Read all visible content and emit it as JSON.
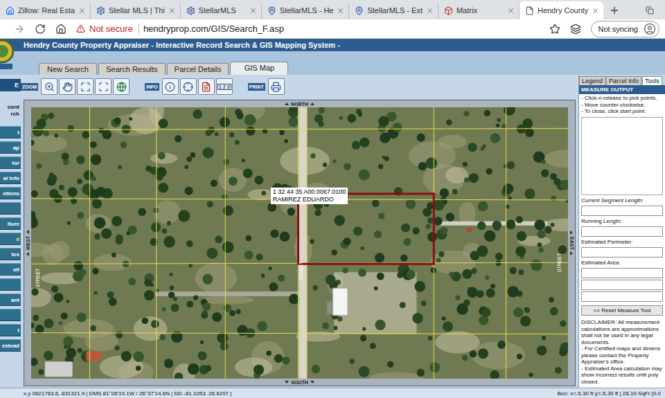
{
  "browser": {
    "tabs": [
      {
        "label": "Zillow: Real Esta",
        "kind": "zillow",
        "selected": false
      },
      {
        "label": "Stellar MLS | Thi",
        "kind": "stellar",
        "selected": false
      },
      {
        "label": "StellarMLS",
        "kind": "stellar",
        "selected": false
      },
      {
        "label": "StellarMLS - He",
        "kind": "pin",
        "selected": false
      },
      {
        "label": "StellarMLS - Ext",
        "kind": "pin",
        "selected": false
      },
      {
        "label": "Matrix",
        "kind": "matrix",
        "selected": false
      },
      {
        "label": "Hendry County",
        "kind": "page",
        "selected": true
      }
    ],
    "address_bar": {
      "security": "Not secure",
      "url": "hendryprop.com/GIS/Search_F.asp"
    },
    "profile_button": "Not syncing"
  },
  "site": {
    "title": "Hendry County Property Appraiser - Interactive Record Search & GIS Mapping System -",
    "tabs": [
      {
        "label": "New Search",
        "selected": false
      },
      {
        "label": "Search Results",
        "selected": false
      },
      {
        "label": "Parcel Details",
        "selected": false
      },
      {
        "label": "GIS Map",
        "selected": true
      }
    ]
  },
  "sidebar": {
    "title": "E",
    "caption": [
      "cord",
      "rch"
    ],
    "items": [
      {
        "label": "t",
        "highlighted": false
      },
      {
        "label": "ap",
        "highlighted": false
      },
      {
        "label": "tor",
        "highlighted": false
      },
      {
        "label": "al Info",
        "highlighted": false
      },
      {
        "label": "otions",
        "highlighted": false
      },
      {
        "label": "",
        "highlighted": false
      },
      {
        "label": "lture",
        "highlighted": false
      },
      {
        "label": "d",
        "highlighted": true
      },
      {
        "label": "tes",
        "highlighted": false
      },
      {
        "label": "oll",
        "highlighted": false
      },
      {
        "label": "",
        "highlighted": false
      },
      {
        "label": "ant",
        "highlighted": false
      },
      {
        "label": "",
        "highlighted": false
      },
      {
        "label": "t",
        "highlighted": false
      },
      {
        "label": "estead",
        "highlighted": false
      }
    ]
  },
  "toolbar": [
    {
      "label": "ZOOM",
      "buttons": [
        {
          "kind": "zoom-in",
          "text": ""
        },
        {
          "kind": "pan",
          "text": ""
        },
        {
          "kind": "full-extent",
          "text": ""
        },
        {
          "kind": "zoom-box",
          "text": ""
        },
        {
          "kind": "globe",
          "text": ""
        }
      ]
    },
    {
      "label": "INFO",
      "buttons": [
        {
          "kind": "info",
          "text": ""
        },
        {
          "kind": "identify",
          "text": ""
        },
        {
          "kind": "report",
          "text": ""
        },
        {
          "kind": "measure",
          "text": "1 2 3"
        }
      ]
    },
    {
      "label": "PRINT",
      "buttons": [
        {
          "kind": "print",
          "text": ""
        }
      ]
    }
  ],
  "map": {
    "compass": {
      "north": "NORTH",
      "south": "SOUTH",
      "west": "WEST",
      "east": "EAST"
    },
    "parcel": {
      "id": "1 32 44 35 A00 0067.0100",
      "owner": "RAMIREZ EDUARDO"
    },
    "street_labels": [
      "STREET",
      "STREET",
      "STREET"
    ]
  },
  "side_panel": {
    "tabs": [
      {
        "label": "Legend",
        "selected": false
      },
      {
        "label": "Parcel Info",
        "selected": false
      },
      {
        "label": "Tools",
        "selected": true
      }
    ],
    "header": "MEASURE OUTPUT",
    "instructions": [
      "- Click-n-release to pick points.",
      "- Move counter-clockwise.",
      "- To close, click start point."
    ],
    "fields": [
      {
        "label": "Current Segment Length:",
        "values": [
          ""
        ]
      },
      {
        "label": "Running Length:",
        "values": [
          ""
        ]
      },
      {
        "label": "Estimated Perimeter:",
        "values": [
          ""
        ]
      },
      {
        "label": "Estimated Area:",
        "values": [
          "",
          "",
          ""
        ]
      }
    ],
    "reset_button": "<< Reset Measure Tool",
    "disclaimer": [
      "DISCLAIMER: All measurement calculations are approximations shall not be used in any legal documents.",
      "- For Certified maps and dimens please contact the Property Appraiser's office.",
      "- Estimated Area calculation may show incorrect results until poly closed."
    ]
  },
  "status_bar": {
    "coordinates": "x,y 0621763.6, 831321.9 | DMS 81°06'19.1W / 26°37'14.6N | DD -81.1053, 26.6207 |",
    "measurement": "Box: x=-5.30 ft y=-5.30 ft | 28.10 SqFt (0.0"
  }
}
